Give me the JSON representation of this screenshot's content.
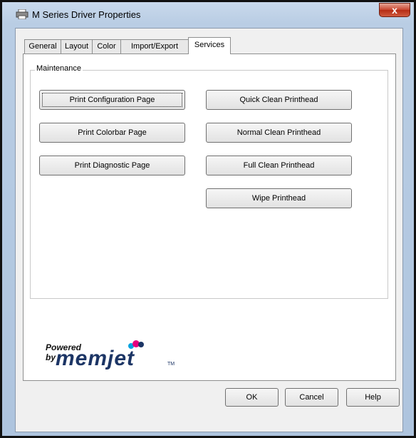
{
  "window": {
    "title": "M Series Driver Properties",
    "close_label": "x"
  },
  "tabs": [
    {
      "label": "General"
    },
    {
      "label": "Layout"
    },
    {
      "label": "Color"
    },
    {
      "label": "Import/Export"
    },
    {
      "label": "Services",
      "active": true
    }
  ],
  "maintenance": {
    "label": "Maintenance",
    "left_buttons": [
      {
        "label": "Print Configuration Page"
      },
      {
        "label": "Print Colorbar Page"
      },
      {
        "label": "Print Diagnostic Page"
      }
    ],
    "right_buttons": [
      {
        "label": "Quick Clean Printhead"
      },
      {
        "label": "Normal Clean Printhead"
      },
      {
        "label": "Full Clean Printhead"
      },
      {
        "label": "Wipe Printhead"
      }
    ]
  },
  "brand": {
    "powered_by": "Powered by",
    "name": "memjet",
    "tm": "TM"
  },
  "footer": {
    "ok": "OK",
    "cancel": "Cancel",
    "help": "Help"
  },
  "colors": {
    "brand_navy": "#1c3565",
    "close_red": "#c7432c"
  }
}
